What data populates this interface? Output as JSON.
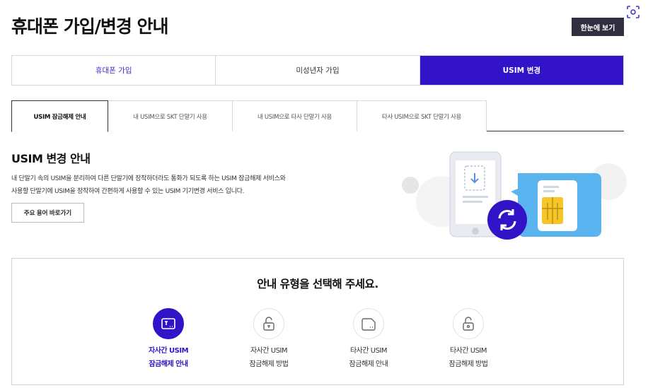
{
  "header": {
    "title": "휴대폰 가입/변경 안내",
    "glance_button": "한눈에 보기"
  },
  "main_tabs": [
    {
      "label": "휴대폰 가입"
    },
    {
      "label": "미성년자 가입"
    },
    {
      "label": "USIM 변경"
    }
  ],
  "sub_tabs": [
    {
      "label": "USIM 잠금해제 안내"
    },
    {
      "label": "내 USIM으로 SKT 단말기 사용"
    },
    {
      "label": "내 USIM으로 타사 단말기 사용"
    },
    {
      "label": "타사 USIM으로 SKT 단말기 사용"
    }
  ],
  "section": {
    "title": "USIM 변경 안내",
    "desc_line1": "내 단말기 속의 USIM을 분리하여 다른 단말기에 장착하더라도 통화가 되도록 하는 USIM 잠금해제 서비스와",
    "desc_line2": "사용할 단말기에 USIM을 장착하여 간편하게 사용할 수 있는 USIM 기기변경 서비스 입니다.",
    "terms_button": "주요 용어 바로가기"
  },
  "selector": {
    "title": "안내 유형을 선택해 주세요.",
    "options": [
      {
        "line1": "자사간 USIM",
        "line2": "잠금해제 안내",
        "icon": "sim-card-icon"
      },
      {
        "line1": "자사간 USIM",
        "line2": "잠금해제 방법",
        "icon": "unlock-icon"
      },
      {
        "line1": "타사간 USIM",
        "line2": "잠금해제 안내",
        "icon": "sim-card-icon"
      },
      {
        "line1": "타사간 USIM",
        "line2": "잠금해제 방법",
        "icon": "unlock-icon"
      }
    ]
  },
  "colors": {
    "accent": "#3213c8",
    "dark_button": "#2f2f3f"
  }
}
